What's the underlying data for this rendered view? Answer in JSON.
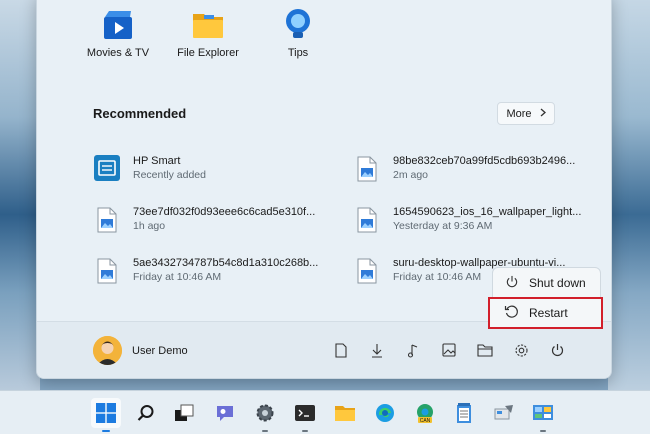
{
  "pinned_apps": [
    {
      "label": "Movies & TV",
      "icon": "movies-tv-icon"
    },
    {
      "label": "File Explorer",
      "icon": "folder-icon"
    },
    {
      "label": "Tips",
      "icon": "tips-bulb-icon"
    }
  ],
  "recommended": {
    "title": "Recommended",
    "more_label": "More",
    "items": [
      {
        "name": "HP Smart",
        "sub": "Recently added",
        "icon": "hp-smart-icon"
      },
      {
        "name": "98be832ceb70a99fd5cdb693b2496...",
        "sub": "2m ago",
        "icon": "image-file-icon"
      },
      {
        "name": "73ee7df032f0d93eee6c6cad5e310f...",
        "sub": "1h ago",
        "icon": "image-file-icon"
      },
      {
        "name": "1654590623_ios_16_wallpaper_light...",
        "sub": "Yesterday at 9:36 AM",
        "icon": "image-file-icon"
      },
      {
        "name": "5ae3432734787b54c8d1a310c268b...",
        "sub": "Friday at 10:46 AM",
        "icon": "image-file-icon"
      },
      {
        "name": "suru-desktop-wallpaper-ubuntu-vi...",
        "sub": "Friday at 10:46 AM",
        "icon": "image-file-icon"
      }
    ]
  },
  "footer": {
    "user_name": "User Demo",
    "icons": [
      "document-icon",
      "downloads-icon",
      "music-icon",
      "pictures-icon",
      "file-explorer-icon",
      "settings-icon",
      "power-icon"
    ]
  },
  "power_menu": {
    "items": [
      {
        "label": "Shut down",
        "icon": "power-icon"
      },
      {
        "label": "Restart",
        "icon": "restart-icon",
        "highlighted": true
      }
    ],
    "highlight_color": "#d21f2b"
  },
  "taskbar": {
    "items": [
      "start-icon",
      "search-icon",
      "task-view-icon",
      "teams-chat-icon",
      "settings-icon",
      "terminal-icon",
      "file-explorer-icon",
      "edge-icon",
      "edge-canary-icon",
      "notepad-icon",
      "snipping-tool-icon",
      "control-panel-icon"
    ],
    "canary_badge": "CAN"
  }
}
